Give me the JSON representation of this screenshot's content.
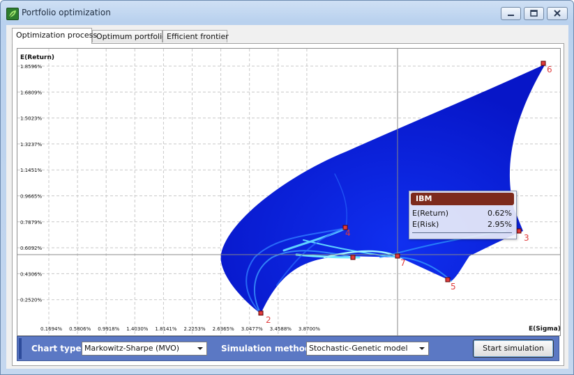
{
  "window": {
    "title": "Portfolio optimization",
    "icon": "green-leaf-icon"
  },
  "tabs": [
    {
      "label": "Optimization process",
      "active": true
    },
    {
      "label": "Optimum portfolios",
      "active": false
    },
    {
      "label": "Efficient frontier",
      "active": false
    }
  ],
  "chart": {
    "y_axis_title": "E(Return)",
    "x_axis_title": "E(Sigma)",
    "y_ticks": [
      "1.8596%",
      "1.6809%",
      "1.5023%",
      "1.3237%",
      "1.1451%",
      "0.9665%",
      "0.7879%",
      "0.6092%",
      "0.4306%",
      "0.2520%"
    ],
    "x_ticks": [
      "0.1694%",
      "0.5806%",
      "0.9918%",
      "1.4030%",
      "1.8141%",
      "2.2253%",
      "2.6365%",
      "3.0477%",
      "3.4588%",
      "3.8700%"
    ],
    "point_labels": [
      "2",
      "3",
      "4",
      "5",
      "6",
      "7"
    ],
    "colors": {
      "cloud": "#0a1edc",
      "highlight": "#64e6ff",
      "marker": "#e03c3c",
      "marker_label": "#e03c3c"
    }
  },
  "tooltip": {
    "name": "IBM",
    "return_label": "E(Return)",
    "return_value": "0.62%",
    "risk_label": "E(Risk)",
    "risk_value": "2.95%"
  },
  "toolbar": {
    "chart_type_label": "Chart type:",
    "chart_type_value": "Markowitz-Sharpe (MVO)",
    "sim_method_label": "Simulation method:",
    "sim_method_value": "Stochastic-Genetic model",
    "start_label": "Start simulation"
  }
}
